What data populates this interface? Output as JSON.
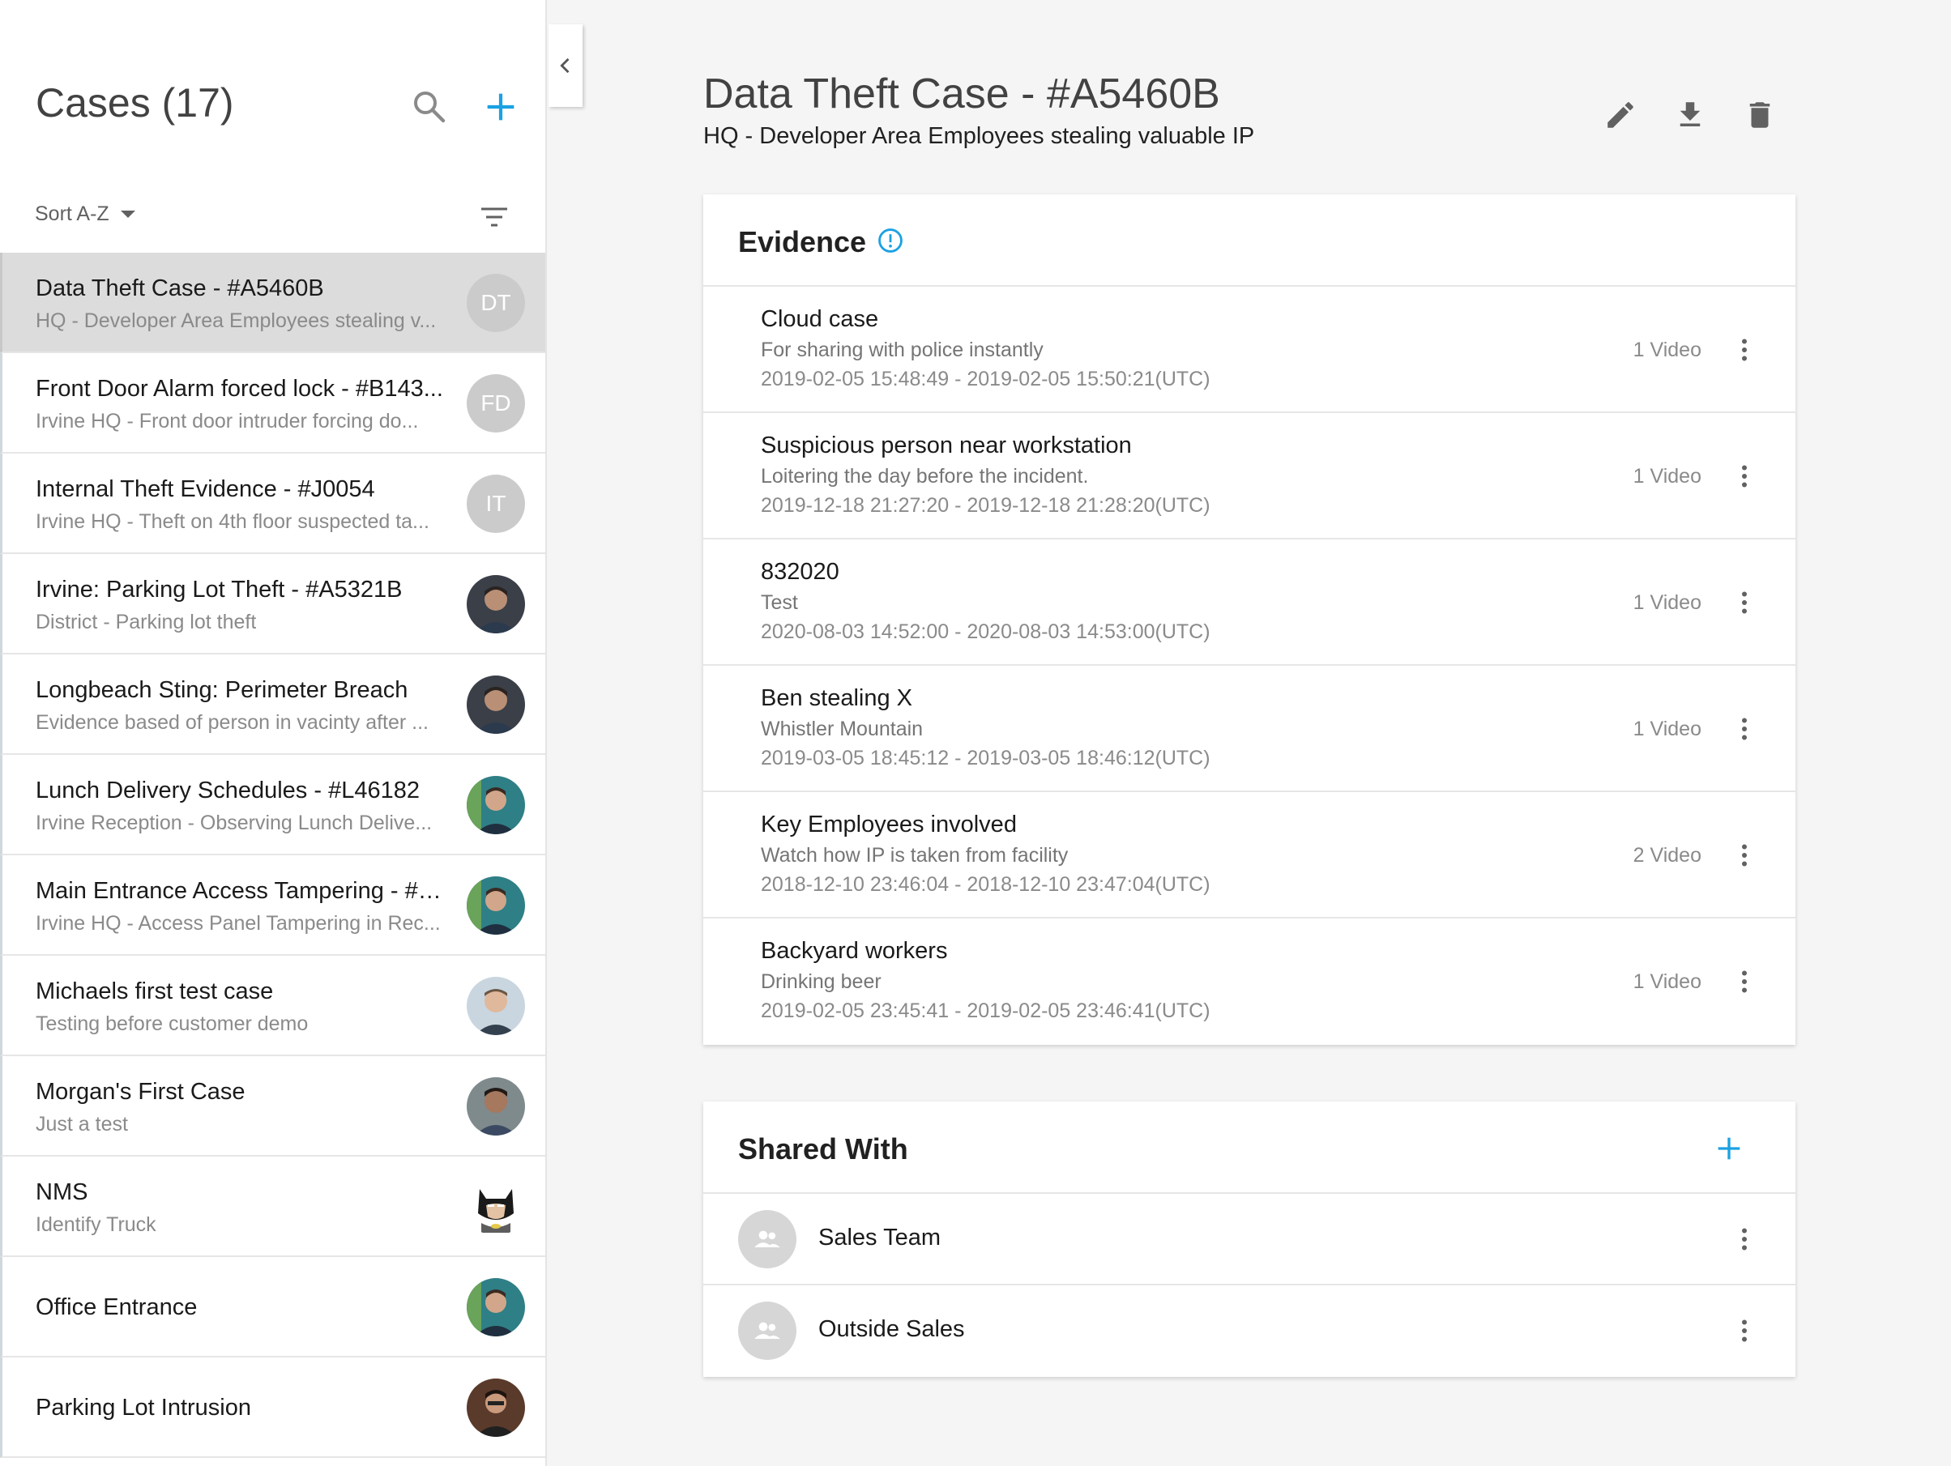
{
  "sidebar": {
    "title": "Cases (17)",
    "sort_label": "Sort A-Z",
    "accent_color": "#1ba1e2",
    "cases": [
      {
        "title": "Data Theft Case - #A5460B",
        "subtitle": "HQ - Developer Area Employees stealing v...",
        "avatar_initials": "DT",
        "avatar_type": "initials",
        "selected": true
      },
      {
        "title": "Front Door Alarm forced lock - #B143...",
        "subtitle": "Irvine HQ - Front door intruder forcing do...",
        "avatar_initials": "FD",
        "avatar_type": "initials"
      },
      {
        "title": "Internal Theft Evidence - #J0054",
        "subtitle": "Irvine HQ - Theft on 4th floor suspected ta...",
        "avatar_initials": "IT",
        "avatar_type": "initials"
      },
      {
        "title": "Irvine: Parking Lot Theft - #A5321B",
        "subtitle": "District - Parking lot theft",
        "avatar_type": "photo-dark"
      },
      {
        "title": "Longbeach Sting: Perimeter Breach",
        "subtitle": "Evidence based of person in vacinty after ...",
        "avatar_type": "photo-dark"
      },
      {
        "title": "Lunch Delivery Schedules - #L46182",
        "subtitle": "Irvine Reception - Observing Lunch Delive...",
        "avatar_type": "photo-teal"
      },
      {
        "title": "Main Entrance Access Tampering - #A...",
        "subtitle": "Irvine HQ - Access Panel Tampering in Rec...",
        "avatar_type": "photo-teal"
      },
      {
        "title": "Michaels first test case",
        "subtitle": "Testing before customer demo",
        "avatar_type": "photo-light"
      },
      {
        "title": "Morgan's First Case",
        "subtitle": "Just a test",
        "avatar_type": "photo-grey"
      },
      {
        "title": "NMS",
        "subtitle": "Identify Truck",
        "avatar_type": "batman"
      },
      {
        "title": "Office Entrance",
        "subtitle": "",
        "avatar_type": "photo-teal"
      },
      {
        "title": "Parking Lot Intrusion",
        "subtitle": "",
        "avatar_type": "photo-brown"
      }
    ]
  },
  "main": {
    "title": "Data Theft Case - #A5460B",
    "subtitle": "HQ - Developer Area Employees stealing valuable IP",
    "tools": [
      "pencil-icon",
      "download-icon",
      "trash-icon"
    ]
  },
  "evidence": {
    "heading": "Evidence",
    "items": [
      {
        "title": "Cloud case",
        "desc": "For sharing with police instantly",
        "time": "2019-02-05 15:48:49 - 2019-02-05 15:50:21(UTC)",
        "count": "1 Video"
      },
      {
        "title": "Suspicious person near workstation",
        "desc": "Loitering the day before the incident.",
        "time": "2019-12-18 21:27:20 - 2019-12-18 21:28:20(UTC)",
        "count": "1 Video"
      },
      {
        "title": "832020",
        "desc": "Test",
        "time": "2020-08-03 14:52:00 - 2020-08-03 14:53:00(UTC)",
        "count": "1 Video"
      },
      {
        "title": "Ben stealing X",
        "desc": "Whistler Mountain",
        "time": "2019-03-05 18:45:12 - 2019-03-05 18:46:12(UTC)",
        "count": "1 Video"
      },
      {
        "title": "Key Employees involved",
        "desc": "Watch how IP is taken from facility",
        "time": "2018-12-10 23:46:04 - 2018-12-10 23:47:04(UTC)",
        "count": "2 Video"
      },
      {
        "title": "Backyard workers",
        "desc": "Drinking beer",
        "time": "2019-02-05 23:45:41 - 2019-02-05 23:46:41(UTC)",
        "count": "1 Video"
      }
    ]
  },
  "shared": {
    "heading": "Shared With",
    "items": [
      {
        "name": "Sales Team"
      },
      {
        "name": "Outside Sales"
      }
    ]
  }
}
